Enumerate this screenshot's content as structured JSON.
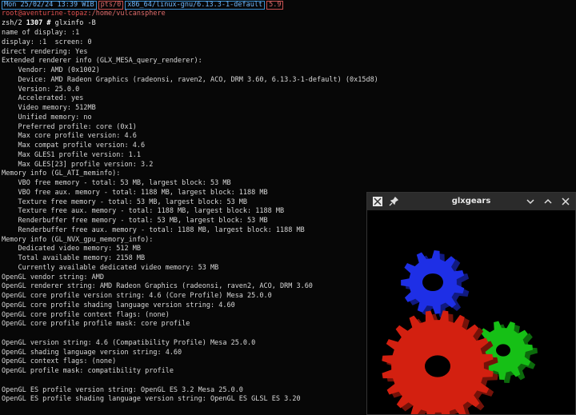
{
  "statusbar": {
    "segments": [
      "Mon 25/02/24 13:39 WIB",
      "pts/0",
      "x86_64/linux-gnu/6.13.3-1-default",
      "5.9"
    ]
  },
  "prompt": {
    "userhost": "root@aventurine-topaz",
    "path": ":/home/vulcansphere"
  },
  "command": {
    "prefix": "zsh/2",
    "number": "1307",
    "symbol": "#",
    "text": "glxinfo -B"
  },
  "output_lines": [
    "name of display: :1",
    "display: :1  screen: 0",
    "direct rendering: Yes",
    "Extended renderer info (GLX_MESA_query_renderer):",
    "    Vendor: AMD (0x1002)",
    "    Device: AMD Radeon Graphics (radeonsi, raven2, ACO, DRM 3.60, 6.13.3-1-default) (0x15d8)",
    "    Version: 25.0.0",
    "    Accelerated: yes",
    "    Video memory: 512MB",
    "    Unified memory: no",
    "    Preferred profile: core (0x1)",
    "    Max core profile version: 4.6",
    "    Max compat profile version: 4.6",
    "    Max GLES1 profile version: 1.1",
    "    Max GLES[23] profile version: 3.2",
    "Memory info (GL_ATI_meminfo):",
    "    VBO free memory - total: 53 MB, largest block: 53 MB",
    "    VBO free aux. memory - total: 1188 MB, largest block: 1188 MB",
    "    Texture free memory - total: 53 MB, largest block: 53 MB",
    "    Texture free aux. memory - total: 1188 MB, largest block: 1188 MB",
    "    Renderbuffer free memory - total: 53 MB, largest block: 53 MB",
    "    Renderbuffer free aux. memory - total: 1188 MB, largest block: 1188 MB",
    "Memory info (GL_NVX_gpu_memory_info):",
    "    Dedicated video memory: 512 MB",
    "    Total available memory: 2158 MB",
    "    Currently available dedicated video memory: 53 MB",
    "OpenGL vendor string: AMD",
    "OpenGL renderer string: AMD Radeon Graphics (radeonsi, raven2, ACO, DRM 3.60",
    "OpenGL core profile version string: 4.6 (Core Profile) Mesa 25.0.0",
    "OpenGL core profile shading language version string: 4.60",
    "OpenGL core profile context flags: (none)",
    "OpenGL core profile profile mask: core profile",
    "",
    "OpenGL version string: 4.6 (Compatibility Profile) Mesa 25.0.0",
    "OpenGL shading language version string: 4.60",
    "OpenGL context flags: (none)",
    "OpenGL profile mask: compatibility profile",
    "",
    "OpenGL ES profile version string: OpenGL ES 3.2 Mesa 25.0.0",
    "OpenGL ES profile shading language version string: OpenGL ES GLSL ES 3.20"
  ],
  "glxgears": {
    "title": "glxgears",
    "icons": [
      "app-icon",
      "pin-icon",
      "minimize-icon",
      "maximize-icon",
      "close-icon"
    ],
    "colors": {
      "red": "#d32010",
      "green": "#16c016",
      "blue": "#1e2fe6"
    }
  }
}
